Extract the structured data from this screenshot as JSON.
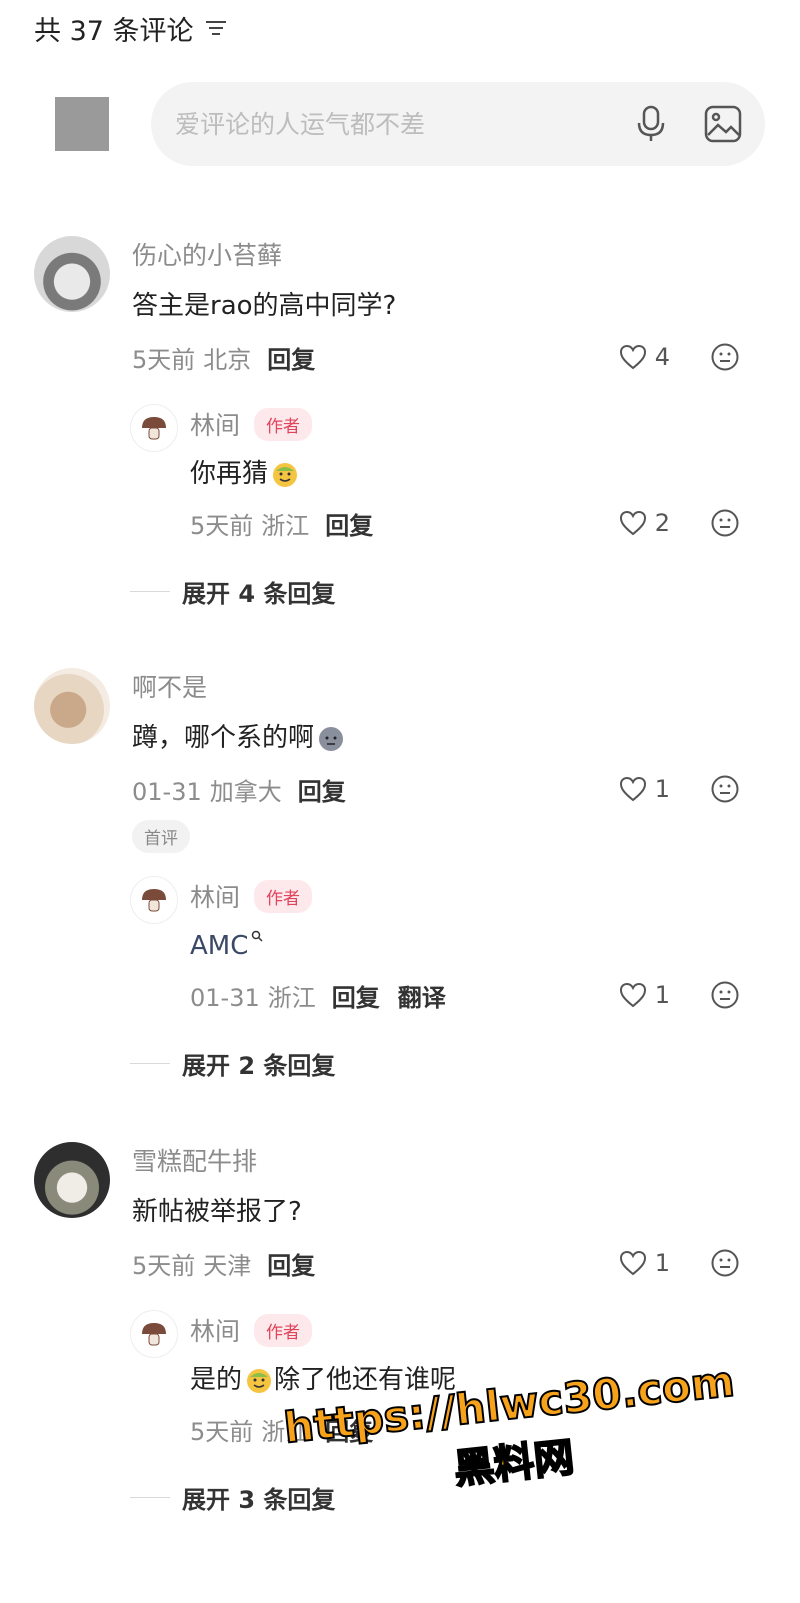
{
  "header": {
    "count_label": "共 37 条评论"
  },
  "composer": {
    "placeholder": "爱评论的人运气都不差"
  },
  "comments": [
    {
      "name": "伤心的小苔藓",
      "text": "答主是rao的高中同学?",
      "time": "5天前",
      "location": "北京",
      "reply_label": "回复",
      "likes": "4",
      "reply": {
        "name": "林间",
        "badge": "作者",
        "text": "你再猜",
        "time": "5天前",
        "location": "浙江",
        "reply_label": "回复",
        "likes": "2"
      },
      "expand_label": "展开 4 条回复"
    },
    {
      "name": "啊不是",
      "text": "蹲，哪个系的啊",
      "time": "01-31",
      "location": "加拿大",
      "reply_label": "回复",
      "likes": "1",
      "first_badge": "首评",
      "reply": {
        "name": "林间",
        "badge": "作者",
        "text": "AMC",
        "time": "01-31",
        "location": "浙江",
        "reply_label": "回复",
        "translate_label": "翻译",
        "likes": "1"
      },
      "expand_label": "展开 2 条回复"
    },
    {
      "name": "雪糕配牛排",
      "text": "新帖被举报了?",
      "time": "5天前",
      "location": "天津",
      "reply_label": "回复",
      "likes": "1",
      "reply": {
        "name": "林间",
        "badge": "作者",
        "text_before": "是的",
        "text_after": "除了他还有谁呢",
        "time": "5天前",
        "location": "浙江",
        "reply_label": "回复"
      },
      "expand_label": "展开 3 条回复"
    }
  ],
  "watermark": {
    "url": "https://hlwc30.com",
    "sub": "黑料网"
  },
  "icons": {
    "filter": "filter-icon",
    "mic": "microphone-icon",
    "image": "image-icon",
    "like": "heart-icon",
    "emoji": "emoji-face-icon",
    "author_avatar": "mushroom-icon"
  },
  "colors": {
    "author_badge": "#e0435a",
    "watermark": "#f7a21b"
  }
}
